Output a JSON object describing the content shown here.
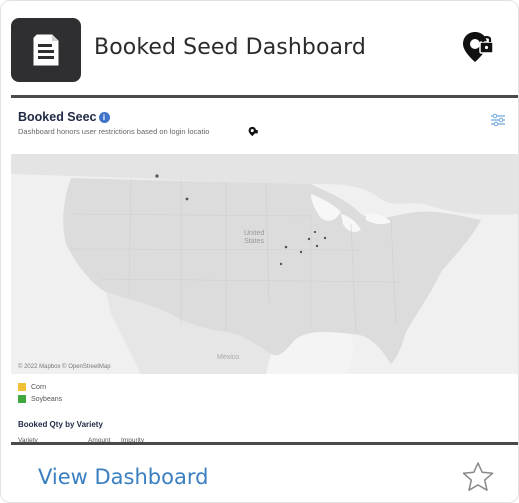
{
  "card": {
    "title": "Booked Seed Dashboard",
    "header_icon": "document-icon",
    "access_icon": "location-lock-icon"
  },
  "preview": {
    "title": "Booked Seec",
    "subtitle": "Dashboard honors user restrictions based on login locatio",
    "map_labels": {
      "us": [
        "United",
        "States"
      ],
      "mexico": "Mexico"
    },
    "map_credit": "© 2022 Mapbox © OpenStreetMap",
    "legend": [
      {
        "label": "Corn",
        "color": "#f2c037"
      },
      {
        "label": "Soybeans",
        "color": "#3ea83e"
      }
    ],
    "table_title": "Booked Qty by Variety",
    "table_headers": [
      "Variety",
      "Amount",
      "Impurity"
    ]
  },
  "footer": {
    "view_label": "View Dashboard",
    "favorite_icon": "star-outline-icon"
  },
  "colors": {
    "link": "#3a7fc1",
    "tile": "#2f2f31"
  }
}
